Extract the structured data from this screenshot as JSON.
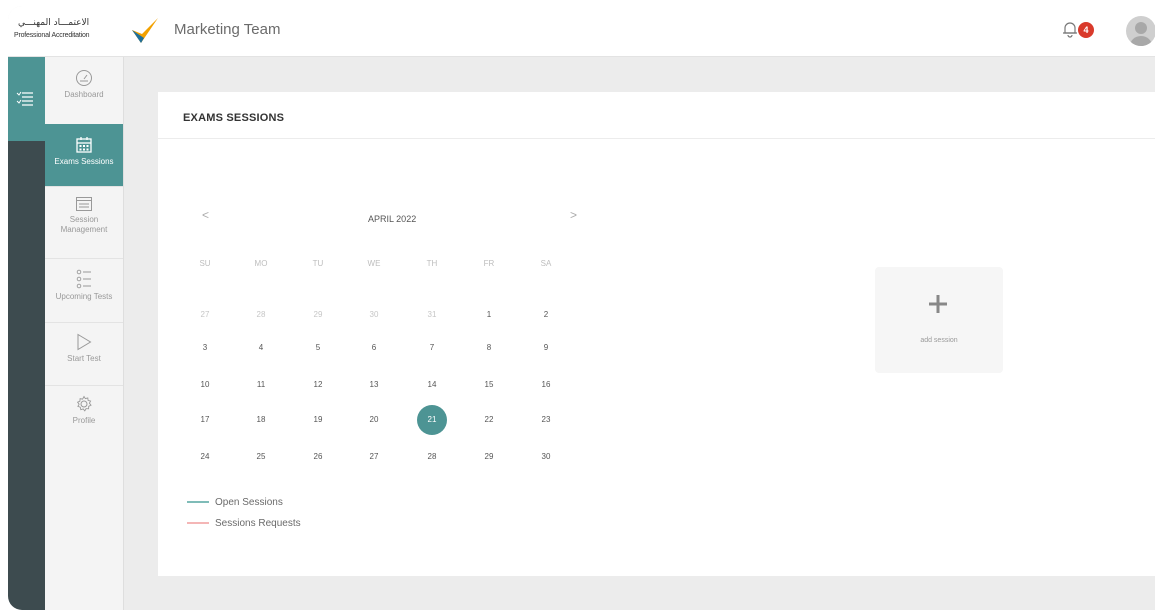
{
  "header": {
    "logo_arabic": "الاعتمـــاد المهنـــي",
    "logo_english": "Professional Accreditation",
    "team_title": "Marketing Team",
    "notification_count": "4"
  },
  "sidebar": {
    "items": [
      {
        "label": "Dashboard",
        "icon": "speedometer-icon"
      },
      {
        "label": "Exams Sessions",
        "icon": "calendar-icon"
      },
      {
        "label": "Session Management",
        "icon": "window-icon"
      },
      {
        "label": "Upcoming Tests",
        "icon": "list-icon"
      },
      {
        "label": "Start Test",
        "icon": "play-icon"
      },
      {
        "label": "Profile",
        "icon": "gear-icon"
      }
    ]
  },
  "main": {
    "title": "EXAMS SESSIONS",
    "calendar": {
      "month_label": "APRIL 2022",
      "prev_label": "<",
      "next_label": ">",
      "weekdays": [
        "SU",
        "MO",
        "TU",
        "WE",
        "TH",
        "FR",
        "SA"
      ],
      "weeks": [
        [
          "27",
          "28",
          "29",
          "30",
          "31",
          "1",
          "2"
        ],
        [
          "3",
          "4",
          "5",
          "6",
          "7",
          "8",
          "9"
        ],
        [
          "10",
          "11",
          "12",
          "13",
          "14",
          "15",
          "16"
        ],
        [
          "17",
          "18",
          "19",
          "20",
          "21",
          "22",
          "23"
        ],
        [
          "24",
          "25",
          "26",
          "27",
          "28",
          "29",
          "30"
        ]
      ],
      "selected_day": "21"
    },
    "legend": [
      {
        "label": "Open Sessions",
        "color": "#7fbcb8"
      },
      {
        "label": "Sessions Requests",
        "color": "#f4b6b6"
      }
    ],
    "add_session_label": "add session"
  },
  "colors": {
    "accent": "#4d9494",
    "badge": "#d93a2b",
    "rail": "#3d4b4f"
  }
}
